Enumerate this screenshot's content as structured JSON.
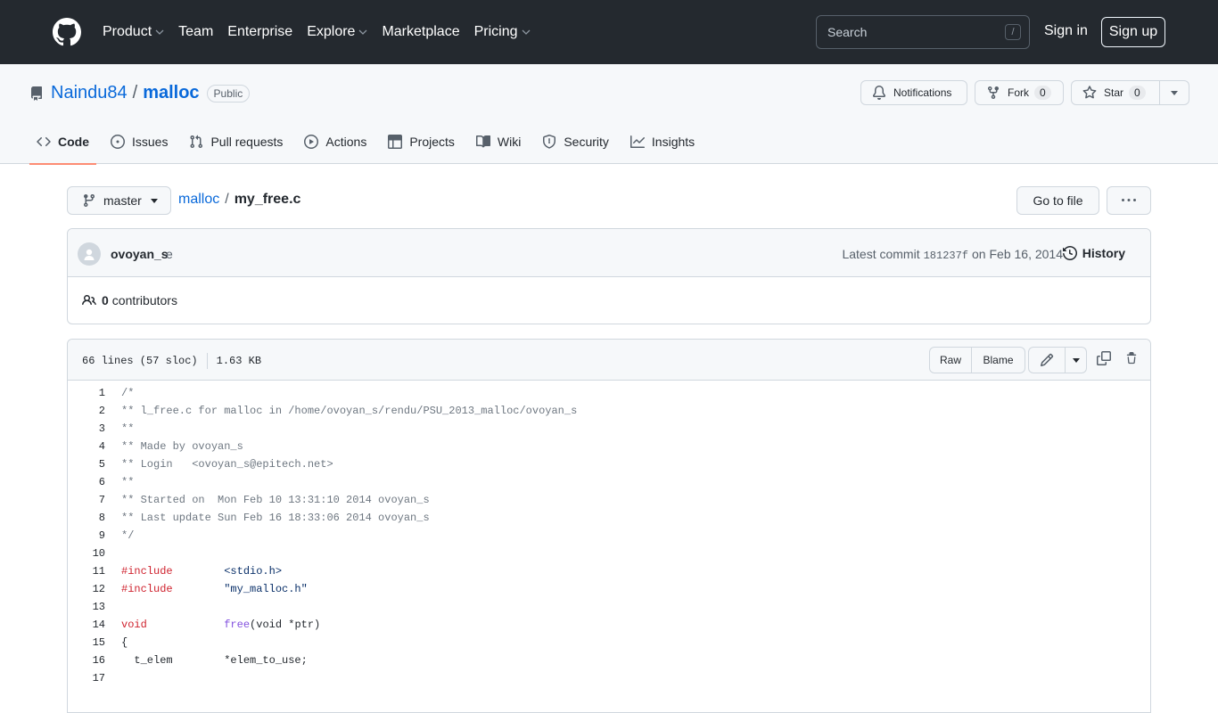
{
  "header": {
    "nav": [
      {
        "label": "Product",
        "dropdown": true
      },
      {
        "label": "Team",
        "dropdown": false
      },
      {
        "label": "Enterprise",
        "dropdown": false
      },
      {
        "label": "Explore",
        "dropdown": true
      },
      {
        "label": "Marketplace",
        "dropdown": false
      },
      {
        "label": "Pricing",
        "dropdown": true
      }
    ],
    "search_placeholder": "Search",
    "search_shortcut": "/",
    "signin": "Sign in",
    "signup": "Sign up"
  },
  "repo": {
    "owner": "Naindu84",
    "separator": "/",
    "name": "malloc",
    "visibility": "Public",
    "notifications_label": "Notifications",
    "fork_label": "Fork",
    "fork_count": "0",
    "star_label": "Star",
    "star_count": "0"
  },
  "tabs": [
    {
      "label": "Code",
      "icon": "code-icon"
    },
    {
      "label": "Issues",
      "icon": "issue-icon"
    },
    {
      "label": "Pull requests",
      "icon": "pull-request-icon"
    },
    {
      "label": "Actions",
      "icon": "play-icon"
    },
    {
      "label": "Projects",
      "icon": "table-icon"
    },
    {
      "label": "Wiki",
      "icon": "book-icon"
    },
    {
      "label": "Security",
      "icon": "shield-icon"
    },
    {
      "label": "Insights",
      "icon": "graph-icon"
    }
  ],
  "filenav": {
    "branch": "master",
    "root": "malloc",
    "separator": "/",
    "file": "my_free.c",
    "goto_file": "Go to file"
  },
  "commit": {
    "author": "ovoyan_s",
    "message": "e",
    "latest_prefix": "Latest commit",
    "sha": "181237f",
    "date": "on Feb 16, 2014",
    "history": "History",
    "contributors_count": "0",
    "contributors_label": "contributors"
  },
  "file": {
    "lines_info": "66 lines (57 sloc)",
    "size": "1.63 KB",
    "raw": "Raw",
    "blame": "Blame"
  },
  "code_lines": [
    {
      "n": "1",
      "t": "/*"
    },
    {
      "n": "2",
      "t": "** l_free.c for malloc in /home/ovoyan_s/rendu/PSU_2013_malloc/ovoyan_s"
    },
    {
      "n": "3",
      "t": "**"
    },
    {
      "n": "4",
      "t": "** Made by ovoyan_s"
    },
    {
      "n": "5",
      "t": "** Login   <ovoyan_s@epitech.net>"
    },
    {
      "n": "6",
      "t": "**"
    },
    {
      "n": "7",
      "t": "** Started on  Mon Feb 10 13:31:10 2014 ovoyan_s"
    },
    {
      "n": "8",
      "t": "** Last update Sun Feb 16 18:33:06 2014 ovoyan_s"
    },
    {
      "n": "9",
      "t": "*/"
    },
    {
      "n": "10",
      "t": ""
    },
    {
      "n": "11",
      "kw": "#include",
      "sp": "        ",
      "rest": "<stdio.h>"
    },
    {
      "n": "12",
      "kw": "#include",
      "sp": "        ",
      "rest": "\"my_malloc.h\""
    },
    {
      "n": "13",
      "t": ""
    },
    {
      "n": "14",
      "kw": "void",
      "sp": "            ",
      "fn": "free",
      "rest": "(void *ptr)"
    },
    {
      "n": "15",
      "t": "{"
    },
    {
      "n": "16",
      "t": "  t_elem        *elem_to_use;"
    },
    {
      "n": "17",
      "t": ""
    }
  ],
  "colors": {
    "header_bg": "#24292f",
    "link": "#0969da",
    "active_tab_underline": "#fd8c73",
    "keyword": "#cf222e",
    "function": "#8250df",
    "string": "#0a3069",
    "comment": "#6e7781"
  }
}
